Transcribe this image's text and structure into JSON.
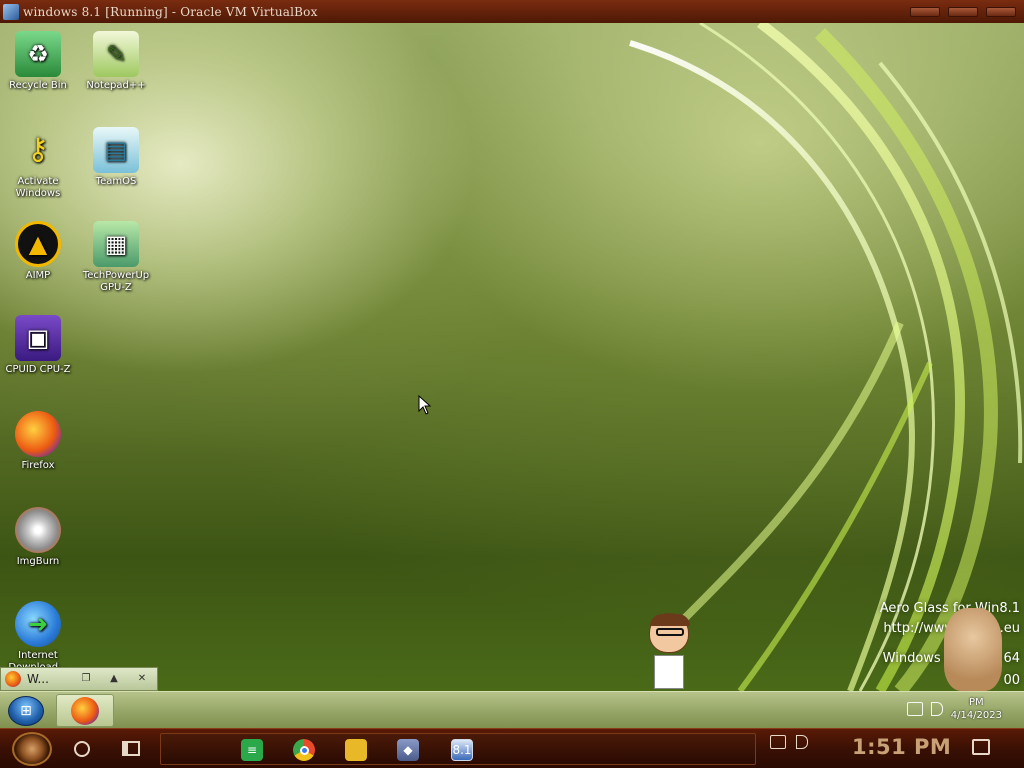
{
  "host_window": {
    "title": "windows 8.1 [Running] - Oracle VM VirtualBox",
    "controls": [
      "minimize-icon",
      "restore-icon",
      "close-icon"
    ]
  },
  "desktop_icons": [
    {
      "label": "Recycle Bin",
      "icon": "recycle-bin-icon",
      "color": "#3aa04a"
    },
    {
      "label": "Notepad++",
      "icon": "notepadpp-icon",
      "color": "#cfe8a0"
    },
    {
      "label": "Activate Windows",
      "icon": "key-icon",
      "color": "#e8c020"
    },
    {
      "label": "TeamOS",
      "icon": "teamos-icon",
      "color": "#a8d8e8"
    },
    {
      "label": "AIMP",
      "icon": "aimp-icon",
      "color": "#f2b800"
    },
    {
      "label": "TechPowerUp GPU-Z",
      "icon": "gpuz-icon",
      "color": "#6aa8d8"
    },
    {
      "label": "CPUID CPU-Z",
      "icon": "cpuz-icon",
      "color": "#5a2ea0"
    },
    {
      "label": "Firefox",
      "icon": "firefox-icon",
      "color": "#e8601a"
    },
    {
      "label": "ImgBurn",
      "icon": "imgburn-icon",
      "color": "#c0c0c0"
    },
    {
      "label": "Internet Download...",
      "icon": "idm-icon",
      "color": "#2a8ad8"
    }
  ],
  "aero_watermark": {
    "line1": "Aero Glass for Win8.1",
    "line2": "http://www.glass8.eu",
    "line3": "Windows 8.1 Aero 64",
    "line4": "00"
  },
  "mini_window": {
    "title": "W...",
    "buttons": [
      "restore-icon",
      "maximize-icon",
      "close-icon"
    ]
  },
  "guest_taskbar": {
    "start": "start-orb-icon",
    "pinned": [
      "firefox-icon"
    ],
    "clock_time": "PM",
    "clock_date": "4/14/2023"
  },
  "host_taskbar": {
    "apps": [
      {
        "name": "notes-icon",
        "color": "#2aa84a"
      },
      {
        "name": "chrome-icon",
        "color": "#e84a2a"
      },
      {
        "name": "file-explorer-icon",
        "color": "#e8b828"
      },
      {
        "name": "virtualbox-icon",
        "color": "#6a7aa8"
      },
      {
        "name": "windows81-vm-icon",
        "color": "#3a6ab8"
      }
    ],
    "clock": "1:51 PM"
  }
}
